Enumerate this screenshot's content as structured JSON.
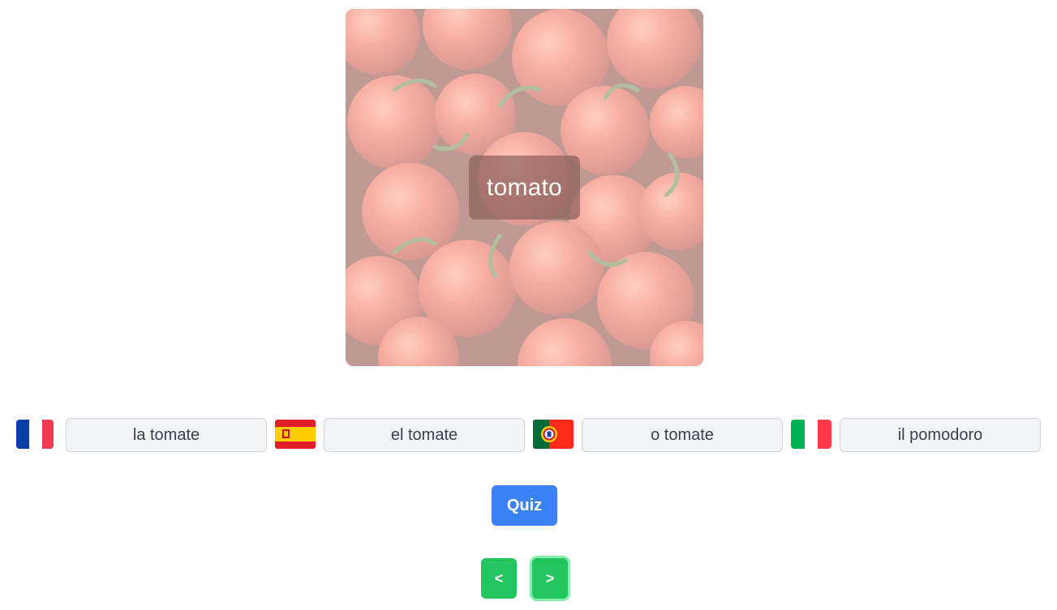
{
  "card": {
    "image": "tomatoes-photo",
    "word": "tomato"
  },
  "translations": [
    {
      "flag": "france-flag-icon",
      "text": "la tomate"
    },
    {
      "flag": "spain-flag-icon",
      "text": "el tomate"
    },
    {
      "flag": "portugal-flag-icon",
      "text": "o tomate"
    },
    {
      "flag": "italy-flag-icon",
      "text": "il pomodoro"
    }
  ],
  "actions": {
    "quiz_label": "Quiz",
    "prev_label": "<",
    "next_label": ">"
  },
  "colors": {
    "quiz": "#3b82f6",
    "nav": "#22c55e",
    "translation_bg": "#f3f4f6"
  }
}
